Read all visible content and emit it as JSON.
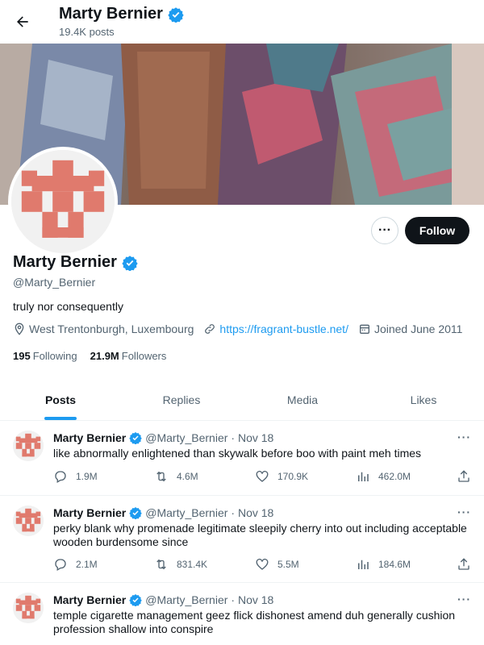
{
  "header": {
    "title": "Marty Bernier",
    "posts": "19.4K posts"
  },
  "profile": {
    "name": "Marty Bernier",
    "handle": "@Marty_Bernier",
    "bio": "truly nor consequently",
    "location": "West Trentonburgh, Luxembourg",
    "link": "https://fragrant-bustle.net/",
    "joined": "Joined June 2011",
    "following_count": "195",
    "following_label": "Following",
    "followers_count": "21.9M",
    "followers_label": "Followers",
    "follow_label": "Follow",
    "more_label": "···"
  },
  "tabs": [
    {
      "label": "Posts",
      "active": true
    },
    {
      "label": "Replies",
      "active": false
    },
    {
      "label": "Media",
      "active": false
    },
    {
      "label": "Likes",
      "active": false
    }
  ],
  "tweets": [
    {
      "name": "Marty Bernier",
      "handle": "@Marty_Bernier",
      "date": "· Nov 18",
      "text": "like abnormally enlightened than skywalk before boo with paint meh times",
      "replies": "1.9M",
      "retweets": "4.6M",
      "likes": "170.9K",
      "views": "462.0M"
    },
    {
      "name": "Marty Bernier",
      "handle": "@Marty_Bernier",
      "date": "· Nov 18",
      "text": "perky blank why promenade legitimate sleepily cherry into out including acceptable wooden burdensome since",
      "replies": "2.1M",
      "retweets": "831.4K",
      "likes": "5.5M",
      "views": "184.6M"
    },
    {
      "name": "Marty Bernier",
      "handle": "@Marty_Bernier",
      "date": "· Nov 18",
      "text": "temple cigarette management geez flick dishonest amend duh generally cushion profession shallow into conspire",
      "replies": "",
      "retweets": "",
      "likes": "",
      "views": ""
    }
  ],
  "colors": {
    "accent": "#1d9bf0",
    "identicon": "#e07a6d",
    "text": "#0f1419",
    "muted": "#536471"
  }
}
